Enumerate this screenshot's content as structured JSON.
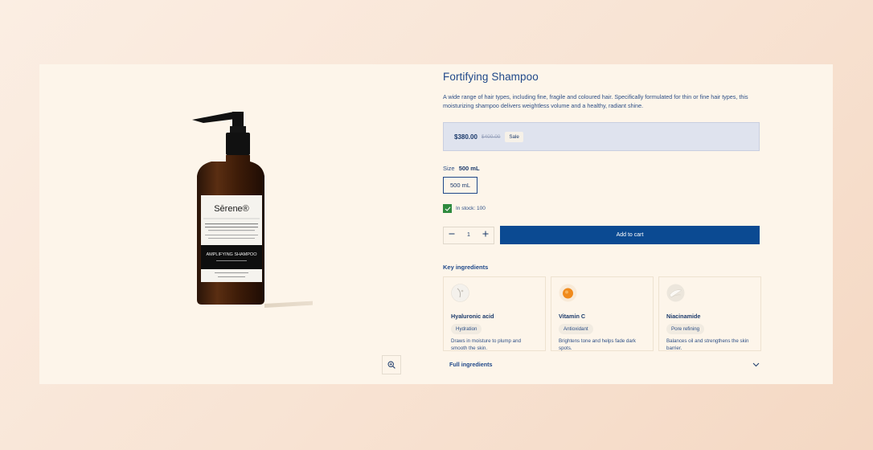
{
  "product": {
    "title": "Fortifying Shampoo",
    "description": "A wide range of hair types, including fine, fragile and coloured hair. Specifically formulated for thin or fine hair types, this moisturizing shampoo delivers weightless volume and a healthy, radiant shine.",
    "price": "$380.00",
    "compare_price": "$400.00",
    "sale_badge": "Sale",
    "size_label": "Size",
    "size_value": "500 mL",
    "size_options": [
      "500 mL"
    ],
    "stock_text": "In stock: 100",
    "quantity": "1",
    "add_to_cart": "Add to cart"
  },
  "bottle_label": {
    "brand": "Sērene®",
    "name": "AMPLIFYING SHAMPOO"
  },
  "ingredients": {
    "title": "Key ingredients",
    "items": [
      {
        "name": "Hyaluronic acid",
        "tag": "Hydration",
        "text": "Draws in moisture to plump and smooth the skin.",
        "icon": "hyaluronic-icon"
      },
      {
        "name": "Vitamin C",
        "tag": "Antioxidant",
        "text": "Brightens tone and helps fade dark spots.",
        "icon": "vitamin-c-icon"
      },
      {
        "name": "Niacinamide",
        "tag": "Pore refining",
        "text": "Balances oil and strengthens the skin barrier.",
        "icon": "niacinamide-icon"
      }
    ],
    "full_label": "Full ingredients"
  },
  "colors": {
    "accent": "#0b4a92",
    "text": "#1b3a6b",
    "stock_green": "#2e8a3e",
    "card_bg": "#fdf5ea",
    "price_bg": "#dfe3ee"
  }
}
